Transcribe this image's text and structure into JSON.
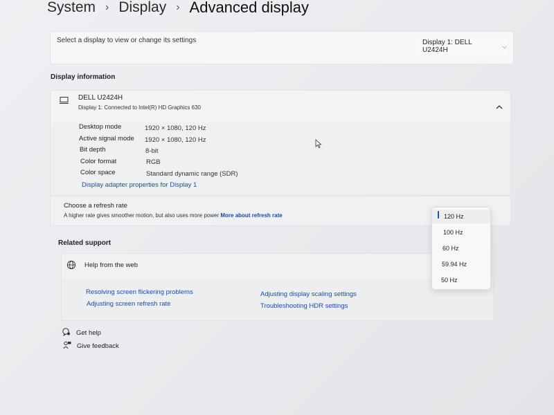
{
  "breadcrumb": {
    "items": [
      "System",
      "Display",
      "Advanced display"
    ],
    "separator": "›"
  },
  "select_display": {
    "label": "Select a display to view or change its settings",
    "selected": "Display 1: DELL U2424H"
  },
  "display_info": {
    "section_title": "Display information",
    "monitor_name": "DELL U2424H",
    "monitor_sub": "Display 1: Connected to Intel(R) HD Graphics 630",
    "properties": [
      {
        "label": "Desktop mode",
        "value": "1920 × 1080, 120 Hz"
      },
      {
        "label": "Active signal mode",
        "value": "1920 × 1080, 120 Hz"
      },
      {
        "label": "Bit depth",
        "value": "8-bit"
      },
      {
        "label": "Color format",
        "value": "RGB"
      },
      {
        "label": "Color space",
        "value": "Standard dynamic range (SDR)"
      }
    ],
    "adapter_link": "Display adapter properties for Display 1"
  },
  "refresh_rate": {
    "title": "Choose a refresh rate",
    "subtitle": "A higher rate gives smoother motion, but also uses more power",
    "more_link": "More about refresh rate",
    "options": [
      "120 Hz",
      "100 Hz",
      "60 Hz",
      "59.94 Hz",
      "50 Hz"
    ],
    "selected": "120 Hz"
  },
  "related_support": {
    "title": "Related support",
    "help_label": "Help from the web",
    "links": [
      "Resolving screen flickering problems",
      "Adjusting display scaling settings",
      "Adjusting screen refresh rate",
      "Troubleshooting HDR settings"
    ]
  },
  "footer": {
    "get_help": "Get help",
    "give_feedback": "Give feedback"
  },
  "colors": {
    "accent": "#1d4fb0",
    "link": "#2249a8"
  },
  "icons": [
    "chevron-right-icon",
    "chevron-down-icon",
    "monitor-icon",
    "chevron-up-icon",
    "globe-icon",
    "get-help-icon",
    "feedback-icon",
    "mouse-pointer-icon"
  ]
}
